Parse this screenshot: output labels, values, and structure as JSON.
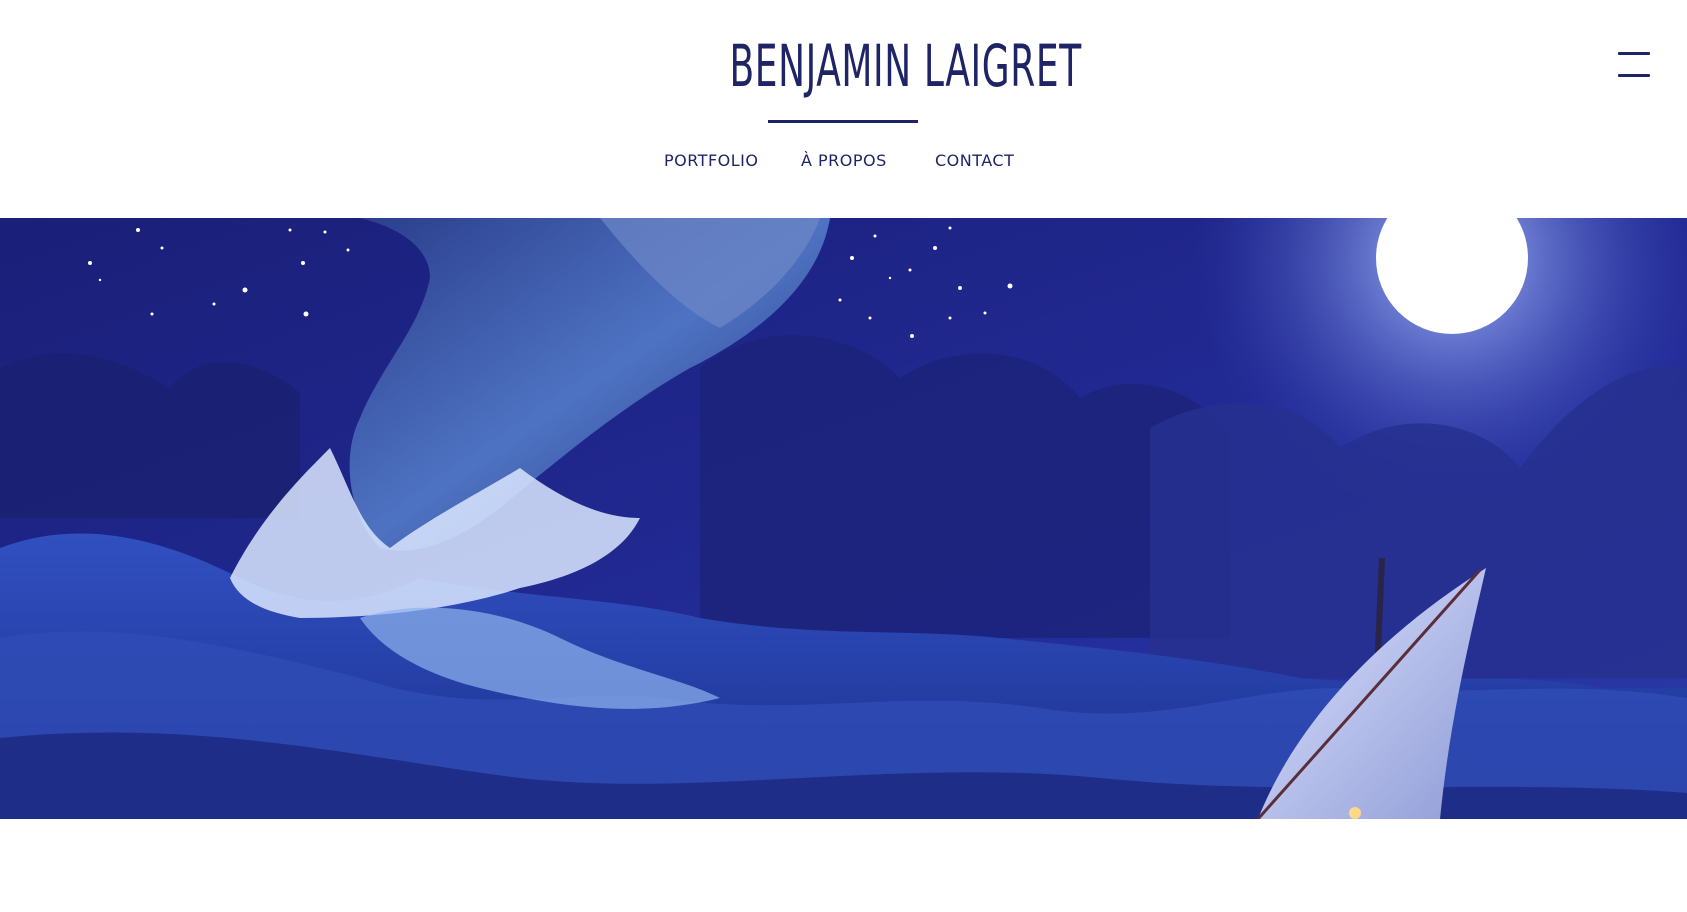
{
  "header": {
    "title": "BENJAMIN LAIGRET",
    "nav": {
      "portfolio": "PORTFOLIO",
      "apropos": "À PROPOS",
      "contact": "CONTACT"
    },
    "menu_icon": "hamburger-menu-icon"
  },
  "hero": {
    "illustration": "night-sea-whale-sailboat-painting"
  },
  "colors": {
    "brand": "#1e2466",
    "background": "#ffffff",
    "night_sky": "#1b2280",
    "moon": "#ffffff"
  }
}
